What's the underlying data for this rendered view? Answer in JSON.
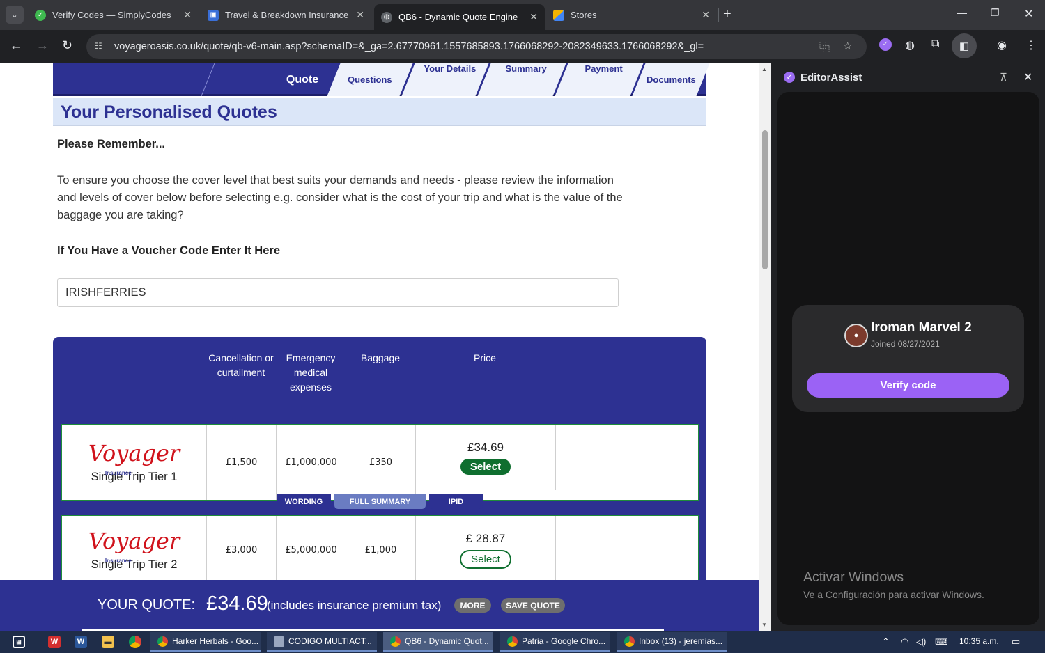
{
  "browser": {
    "tabs": [
      {
        "title": "Verify Codes — SimplyCodes",
        "active": false
      },
      {
        "title": "Travel & Breakdown Insurance |",
        "active": false
      },
      {
        "title": "QB6 - Dynamic Quote Engine",
        "active": true
      },
      {
        "title": "Stores",
        "active": false
      }
    ],
    "url": "voyageroasis.co.uk/quote/qb-v6-main.asp?schemaID=&_ga=2.67770961.1557685893.1766068292-2082349633.1766068292&_gl="
  },
  "steps": [
    "Quote",
    "Questions",
    "Your Details",
    "Summary",
    "Payment",
    "Documents"
  ],
  "page": {
    "heading": "Your Personalised Quotes",
    "remember": "Please Remember...",
    "advice": "To ensure you choose the cover level that best suits your demands and needs - please review the information and levels of cover below before selecting e.g. consider what is the cost of your trip and what is the value of the baggage you are taking?",
    "voucher_label": "If You Have a Voucher Code Enter It Here",
    "voucher_value": "IRISHFERRIES"
  },
  "quote_table": {
    "columns": [
      "Cancellation or curtailment",
      "Emergency medical expenses",
      "Baggage",
      "Price"
    ],
    "brand": "Voyager",
    "brand_sub": "Insurance",
    "rows": [
      {
        "tier": "Single Trip Tier 1",
        "cancellation": "£1,500",
        "medical": "£1,000,000",
        "baggage": "£350",
        "price": "£34.69",
        "select": "Select"
      },
      {
        "tier": "Single Trip Tier 2",
        "cancellation": "£3,000",
        "medical": "£5,000,000",
        "baggage": "£1,000",
        "price": "£ 28.87",
        "select": "Select"
      }
    ],
    "doc_tabs": [
      "WORDING",
      "FULL SUMMARY",
      "IPID"
    ]
  },
  "footer": {
    "label": "YOUR QUOTE:",
    "price": "£34.69",
    "tax_note": "(includes insurance premium tax)",
    "more": "MORE",
    "save": "SAVE QUOTE"
  },
  "sidepanel": {
    "title": "EditorAssist",
    "user": "Iroman Marvel 2",
    "joined": "Joined 08/27/2021",
    "verify_button": "Verify code",
    "watermark_title": "Activar Windows",
    "watermark_sub": "Ve a Configuración para activar Windows."
  },
  "taskbar": {
    "apps": [
      "Harker Herbals - Goo...",
      "CODIGO MULTIACT...",
      "QB6 - Dynamic Quot...",
      "Patria - Google Chro...",
      "Inbox (13) - jeremias..."
    ],
    "time": "10:35 a.m."
  },
  "colors": {
    "brand_navy": "#2d3192",
    "select_green": "#0f6f2f",
    "verify_purple": "#9b62f5"
  }
}
